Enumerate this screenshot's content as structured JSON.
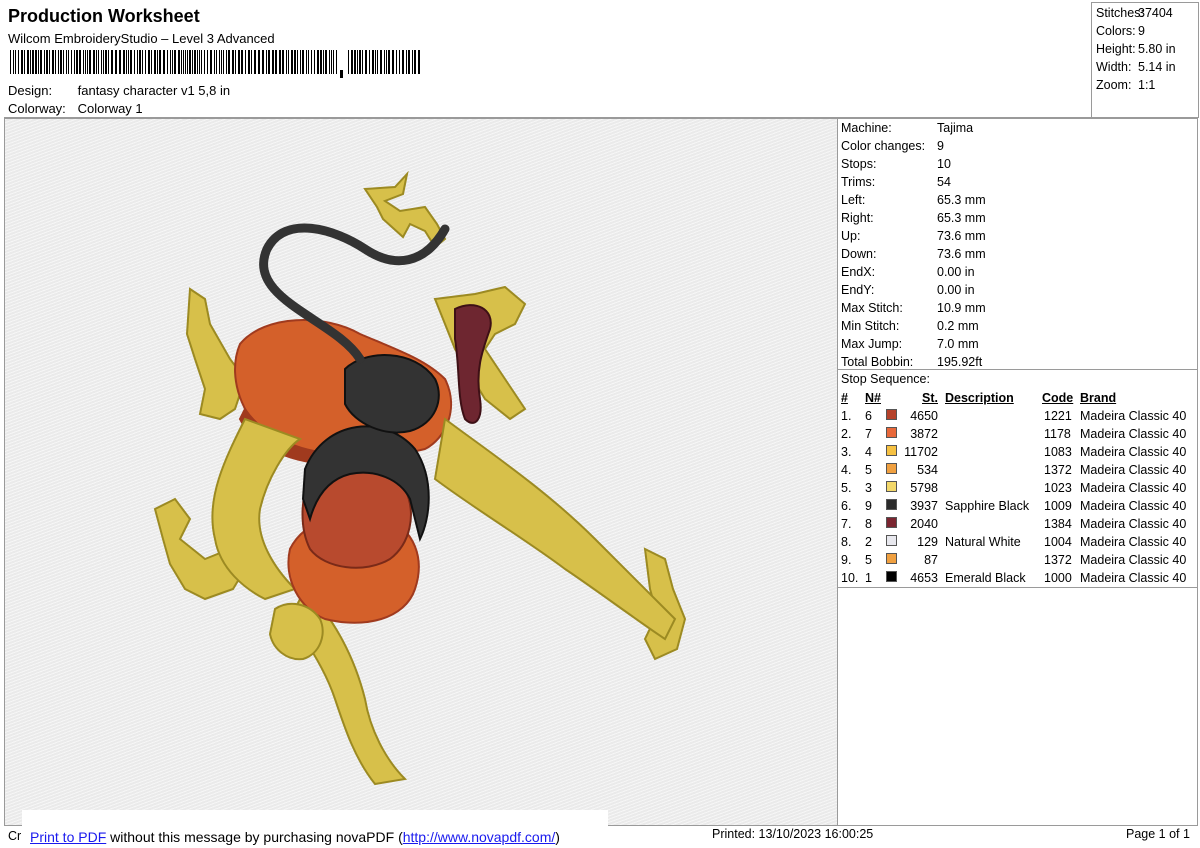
{
  "header": {
    "title": "Production Worksheet",
    "subtitle": "Wilcom EmbroideryStudio – Level 3 Advanced",
    "design_label": "Design:",
    "design_value": "fantasy character v1 5,8 in",
    "colorway_label": "Colorway:",
    "colorway_value": "Colorway 1"
  },
  "stats": {
    "stitches_label": "Stitches:",
    "stitches": "37404",
    "colors_label": "Colors:",
    "colors": "9",
    "height_label": "Height:",
    "height": "5.80 in",
    "width_label": "Width:",
    "width": "5.14 in",
    "zoom_label": "Zoom:",
    "zoom": "1:1"
  },
  "machine_info": [
    {
      "label": "Machine:",
      "value": "Tajima"
    },
    {
      "label": "Color changes:",
      "value": "9"
    },
    {
      "label": "Stops:",
      "value": "10"
    },
    {
      "label": "Trims:",
      "value": "54"
    },
    {
      "label": "Left:",
      "value": "65.3 mm"
    },
    {
      "label": "Right:",
      "value": "65.3 mm"
    },
    {
      "label": "Up:",
      "value": "73.6 mm"
    },
    {
      "label": "Down:",
      "value": "73.6 mm"
    },
    {
      "label": "EndX:",
      "value": "0.00 in"
    },
    {
      "label": "EndY:",
      "value": "0.00 in"
    },
    {
      "label": "Max Stitch:",
      "value": "10.9 mm"
    },
    {
      "label": "Min Stitch:",
      "value": "0.2 mm"
    },
    {
      "label": "Max Jump:",
      "value": "7.0 mm"
    },
    {
      "label": "Total Bobbin:",
      "value": "195.92ft"
    }
  ],
  "stop_sequence": {
    "title": "Stop Sequence:",
    "headers": {
      "num": "#",
      "needle": "N#",
      "stitches": "St.",
      "description": "Description",
      "code": "Code",
      "brand": "Brand"
    },
    "rows": [
      {
        "num": "1.",
        "needle": "6",
        "color": "#b5412a",
        "stitches": "4650",
        "description": "",
        "code": "1221",
        "brand": "Madeira Classic 40"
      },
      {
        "num": "2.",
        "needle": "7",
        "color": "#e8683a",
        "stitches": "3872",
        "description": "",
        "code": "1178",
        "brand": "Madeira Classic 40"
      },
      {
        "num": "3.",
        "needle": "4",
        "color": "#f6c142",
        "stitches": "11702",
        "description": "",
        "code": "1083",
        "brand": "Madeira Classic 40"
      },
      {
        "num": "4.",
        "needle": "5",
        "color": "#f0a040",
        "stitches": "534",
        "description": "",
        "code": "1372",
        "brand": "Madeira Classic 40"
      },
      {
        "num": "5.",
        "needle": "3",
        "color": "#f3d86a",
        "stitches": "5798",
        "description": "",
        "code": "1023",
        "brand": "Madeira Classic 40"
      },
      {
        "num": "6.",
        "needle": "9",
        "color": "#2b2b2b",
        "stitches": "3937",
        "description": "Sapphire Black",
        "code": "1009",
        "brand": "Madeira Classic 40"
      },
      {
        "num": "7.",
        "needle": "8",
        "color": "#7a2530",
        "stitches": "2040",
        "description": "",
        "code": "1384",
        "brand": "Madeira Classic 40"
      },
      {
        "num": "8.",
        "needle": "2",
        "color": "#e8e8ee",
        "stitches": "129",
        "description": "Natural White",
        "code": "1004",
        "brand": "Madeira Classic 40"
      },
      {
        "num": "9.",
        "needle": "5",
        "color": "#f0a040",
        "stitches": "87",
        "description": "",
        "code": "1372",
        "brand": "Madeira Classic 40"
      },
      {
        "num": "10.",
        "needle": "1",
        "color": "#000000",
        "stitches": "4653",
        "description": "Emerald Black",
        "code": "1000",
        "brand": "Madeira Classic 40"
      }
    ]
  },
  "footer": {
    "crop": "Cr",
    "promo_link": "Print to PDF",
    "promo_middle": " without this message by purchasing novaPDF (",
    "promo_url": "http://www.novapdf.com/",
    "promo_end": ")",
    "printed": "Printed: 13/10/2023 16:00:25",
    "page": "Page 1 of 1"
  },
  "design_colors": {
    "yellow": "#d7c04a",
    "yellow_dark": "#9c8a22",
    "orange": "#d4602a",
    "orange_dark": "#a03a1e",
    "black": "#333333",
    "maroon": "#6e2630",
    "skin": "#b84a2e"
  }
}
